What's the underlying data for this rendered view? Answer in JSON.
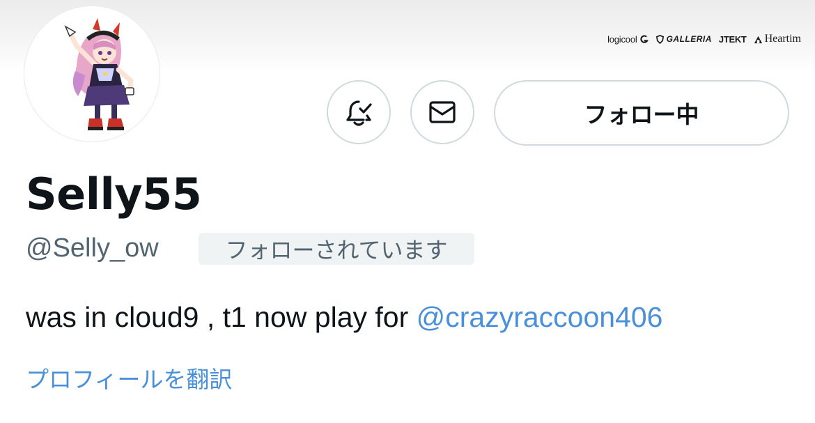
{
  "profile": {
    "display_name": "Selly55",
    "handle": "@Selly_ow",
    "follows_you_badge": "フォローされています",
    "bio_text": "was in cloud9 , t1 now play for ",
    "bio_mention": "@crazyraccoon406",
    "translate_link": "プロフィールを翻訳"
  },
  "actions": {
    "notify_icon": "bell-check-icon",
    "message_icon": "envelope-icon",
    "follow_label": "フォロー中"
  },
  "banner": {
    "sponsors": [
      "logicool",
      "GALLERIA",
      "JTEKT",
      "Heartim"
    ]
  },
  "colors": {
    "link": "#4a90d9",
    "secondary_text": "#536471",
    "border": "#cfd9de",
    "badge_bg": "#eff3f4"
  }
}
